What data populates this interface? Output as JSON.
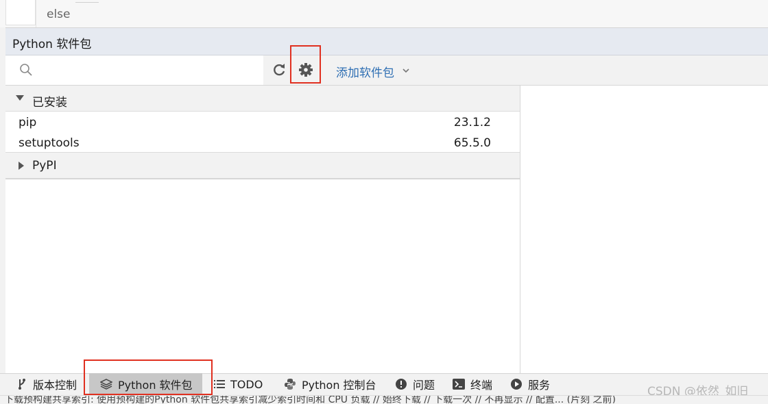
{
  "editor": {
    "code_text": "else"
  },
  "panel": {
    "title": "Python 软件包"
  },
  "toolbar": {
    "search_placeholder": "",
    "refresh_icon": "refresh-icon",
    "settings_icon": "gear-icon",
    "add_package_label": "添加软件包"
  },
  "groups": {
    "installed": {
      "label": "已安装",
      "packages": [
        {
          "name": "pip",
          "version": "23.1.2"
        },
        {
          "name": "setuptools",
          "version": "65.5.0"
        }
      ]
    },
    "pypi": {
      "label": "PyPI"
    }
  },
  "bottom_tabs": [
    {
      "label": "版本控制",
      "icon": "branch-icon"
    },
    {
      "label": "Python 软件包",
      "icon": "layers-icon",
      "active": true
    },
    {
      "label": "TODO",
      "icon": "list-icon"
    },
    {
      "label": "Python 控制台",
      "icon": "python-icon"
    },
    {
      "label": "问题",
      "icon": "warning-circle-icon"
    },
    {
      "label": "终端",
      "icon": "terminal-icon"
    },
    {
      "label": "服务",
      "icon": "play-circle-icon"
    }
  ],
  "watermark": "CSDN @依然_如旧",
  "status_bar": {
    "text": "下载预构建共享索引: 使用预构建的Python 软件包共享索引减少索引时间和 CPU 负载 // 始终下载 // 下载一次 // 不再显示 // 配置... (片刻 之前)"
  },
  "colors": {
    "highlight": "#e02f1f",
    "link": "#2f6fb3",
    "header_bg": "#e6eaf1"
  }
}
